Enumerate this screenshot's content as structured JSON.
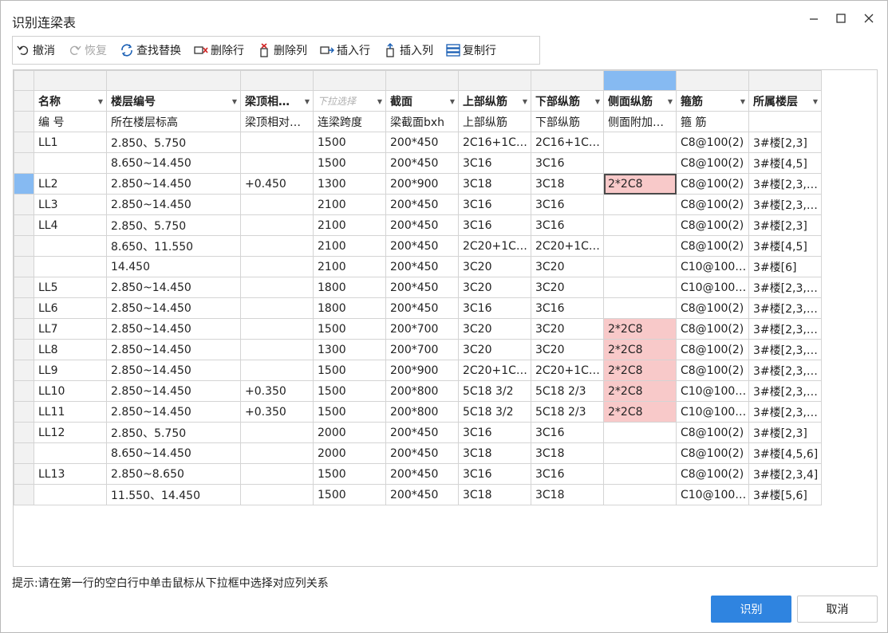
{
  "window": {
    "title": "识别连梁表"
  },
  "toolbar": {
    "undo": "撤消",
    "redo": "恢复",
    "find_replace": "查找替换",
    "delete_row": "删除行",
    "delete_col": "删除列",
    "insert_row": "插入行",
    "insert_col": "插入列",
    "copy_row": "复制行"
  },
  "headers": [
    "名称",
    "楼层编号",
    "梁顶相…",
    "下拉选择",
    "截面",
    "上部纵筋",
    "下部纵筋",
    "侧面纵筋",
    "箍筋",
    "所属楼层"
  ],
  "rows": [
    [
      "编 号",
      "所在楼层标高",
      "梁顶相对…",
      "连梁跨度",
      "梁截面bxh",
      "上部纵筋",
      "下部纵筋",
      "侧面附加…",
      "箍 筋",
      ""
    ],
    [
      "LL1",
      "2.850、5.750",
      "",
      "1500",
      "200*450",
      "2C16+1C…",
      "2C16+1C…",
      "",
      "C8@100(2)",
      "3#楼[2,3]"
    ],
    [
      "",
      "8.650~14.450",
      "",
      "1500",
      "200*450",
      "3C16",
      "3C16",
      "",
      "C8@100(2)",
      "3#楼[4,5]"
    ],
    [
      "LL2",
      "2.850~14.450",
      "+0.450",
      "1300",
      "200*900",
      "3C18",
      "3C18",
      "2*2C8",
      "C8@100(2)",
      "3#楼[2,3,…"
    ],
    [
      "LL3",
      "2.850~14.450",
      "",
      "2100",
      "200*450",
      "3C16",
      "3C16",
      "",
      "C8@100(2)",
      "3#楼[2,3,…"
    ],
    [
      "LL4",
      "2.850、5.750",
      "",
      "2100",
      "200*450",
      "3C16",
      "3C16",
      "",
      "C8@100(2)",
      "3#楼[2,3]"
    ],
    [
      "",
      "8.650、11.550",
      "",
      "2100",
      "200*450",
      "2C20+1C…",
      "2C20+1C…",
      "",
      "C8@100(2)",
      "3#楼[4,5]"
    ],
    [
      "",
      "14.450",
      "",
      "2100",
      "200*450",
      "3C20",
      "3C20",
      "",
      "C10@100…",
      "3#楼[6]"
    ],
    [
      "LL5",
      "2.850~14.450",
      "",
      "1800",
      "200*450",
      "3C20",
      "3C20",
      "",
      "C10@100…",
      "3#楼[2,3,…"
    ],
    [
      "LL6",
      "2.850~14.450",
      "",
      "1800",
      "200*450",
      "3C16",
      "3C16",
      "",
      "C8@100(2)",
      "3#楼[2,3,…"
    ],
    [
      "LL7",
      "2.850~14.450",
      "",
      "1500",
      "200*700",
      "3C20",
      "3C20",
      "2*2C8",
      "C8@100(2)",
      "3#楼[2,3,…"
    ],
    [
      "LL8",
      "2.850~14.450",
      "",
      "1300",
      "200*700",
      "3C20",
      "3C20",
      "2*2C8",
      "C8@100(2)",
      "3#楼[2,3,…"
    ],
    [
      "LL9",
      "2.850~14.450",
      "",
      "1500",
      "200*900",
      "2C20+1C…",
      "2C20+1C…",
      "2*2C8",
      "C8@100(2)",
      "3#楼[2,3,…"
    ],
    [
      "LL10",
      "2.850~14.450",
      "+0.350",
      "1500",
      "200*800",
      "5C18 3/2",
      "5C18 2/3",
      "2*2C8",
      "C10@100…",
      "3#楼[2,3,…"
    ],
    [
      "LL11",
      "2.850~14.450",
      "+0.350",
      "1500",
      "200*800",
      "5C18 3/2",
      "5C18 2/3",
      "2*2C8",
      "C10@100…",
      "3#楼[2,3,…"
    ],
    [
      "LL12",
      "2.850、5.750",
      "",
      "2000",
      "200*450",
      "3C16",
      "3C16",
      "",
      "C8@100(2)",
      "3#楼[2,3]"
    ],
    [
      "",
      "8.650~14.450",
      "",
      "2000",
      "200*450",
      "3C18",
      "3C18",
      "",
      "C8@100(2)",
      "3#楼[4,5,6]"
    ],
    [
      "LL13",
      "2.850~8.650",
      "",
      "1500",
      "200*450",
      "3C16",
      "3C16",
      "",
      "C8@100(2)",
      "3#楼[2,3,4]"
    ],
    [
      "",
      "11.550、14.450",
      "",
      "1500",
      "200*450",
      "3C18",
      "3C18",
      "",
      "C10@100…",
      "3#楼[5,6]"
    ]
  ],
  "hint": "提示:请在第一行的空白行中单击鼠标从下拉框中选择对应列关系",
  "buttons": {
    "ok": "识别",
    "cancel": "取消"
  },
  "colors": {
    "accent": "#2f84e0",
    "highlight_cell": "#f8c9c9",
    "selected_header": "#86baf2"
  }
}
